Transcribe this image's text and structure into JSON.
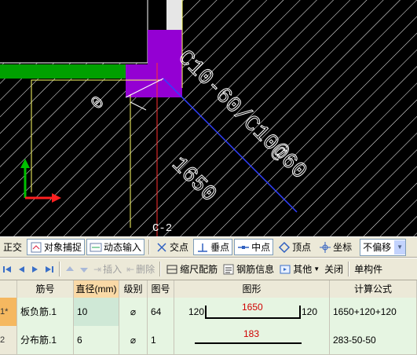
{
  "canvas": {
    "rebar_label": "C10-60/C10@60",
    "dim_label": "1650",
    "small_label": "0",
    "axis_label": "C-2",
    "colors": {
      "background": "#000000",
      "slab_green": "#00a000",
      "beam_purple": "#9400d3",
      "hatch": "#ffffff",
      "rebar_blue": "#3040ff",
      "axis_red": "#ff2020",
      "axis_green": "#00c000",
      "guide_yellow": "#ffff66"
    }
  },
  "snap_toolbar": {
    "items": [
      {
        "label": "正交",
        "icon": "none"
      },
      {
        "label": "对象捕捉",
        "icon": "snap-object-icon"
      },
      {
        "label": "动态输入",
        "icon": "dynamic-input-icon"
      },
      {
        "label": "交点",
        "icon": "intersection-icon"
      },
      {
        "label": "垂点",
        "icon": "perpendicular-icon"
      },
      {
        "label": "中点",
        "icon": "midpoint-icon"
      },
      {
        "label": "顶点",
        "icon": "vertex-icon"
      },
      {
        "label": "坐标",
        "icon": "coordinate-icon"
      }
    ],
    "offset_select": "不偏移"
  },
  "rebar_toolbar": {
    "insert": "插入",
    "delete": "删除",
    "scale_rebar": "缩尺配筋",
    "rebar_info": "钢筋信息",
    "other": "其他",
    "close": "关闭",
    "single_member": "单构件"
  },
  "grid": {
    "headers": [
      "筋号",
      "直径(mm)",
      "级别",
      "图号",
      "图形",
      "计算公式"
    ],
    "rows": [
      {
        "num": "1*",
        "name": "板负筋.1",
        "diameter": "10",
        "grade": "⌀",
        "fig": "64",
        "shape_left": "120",
        "shape_mid": "1650",
        "shape_right": "120",
        "formula": "1650+120+120"
      },
      {
        "num": "2",
        "name": "分布筋.1",
        "diameter": "6",
        "grade": "⌀",
        "fig": "1",
        "shape_left": "",
        "shape_mid": "183",
        "shape_right": "",
        "formula": "283-50-50"
      }
    ]
  }
}
